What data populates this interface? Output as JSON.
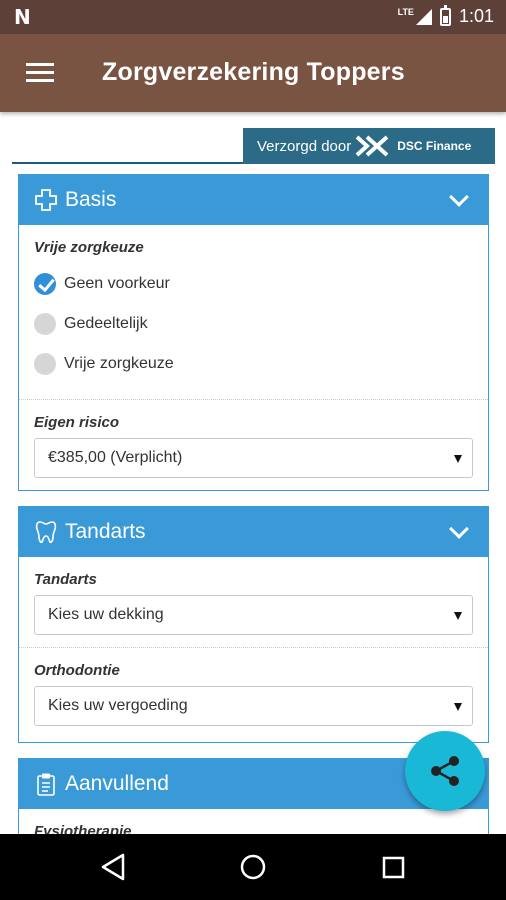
{
  "status_bar": {
    "notification_icon": "n-logo",
    "network": "LTE",
    "time": "1:01"
  },
  "app_bar": {
    "menu_icon": "hamburger-icon",
    "title": "Zorgverzekering Toppers"
  },
  "sponsor": {
    "prefix": "Verzorgd door",
    "company": "DSC Finance"
  },
  "panels": {
    "basis": {
      "title": "Basis",
      "icon": "medical-cross-icon",
      "vrije_zorgkeuze_label": "Vrije zorgkeuze",
      "options": [
        {
          "label": "Geen voorkeur",
          "checked": true
        },
        {
          "label": "Gedeeltelijk",
          "checked": false
        },
        {
          "label": "Vrije zorgkeuze",
          "checked": false
        }
      ],
      "eigen_risico_label": "Eigen risico",
      "eigen_risico_value": "€385,00 (Verplicht)"
    },
    "tandarts": {
      "title": "Tandarts",
      "icon": "tooth-icon",
      "tandarts_label": "Tandarts",
      "tandarts_value": "Kies uw dekking",
      "orthodontie_label": "Orthodontie",
      "orthodontie_value": "Kies uw vergoeding"
    },
    "aanvullend": {
      "title": "Aanvullend",
      "icon": "clipboard-icon",
      "fysio_label": "Fysiotherapie"
    }
  },
  "fab": {
    "icon": "share-icon"
  },
  "colors": {
    "status_bar": "#5d4037",
    "app_bar": "#7a5442",
    "panel_header": "#3a9ad8",
    "sponsor": "#2b6b87",
    "fab": "#19b8d6",
    "radio_checked": "#2f8fd8"
  }
}
